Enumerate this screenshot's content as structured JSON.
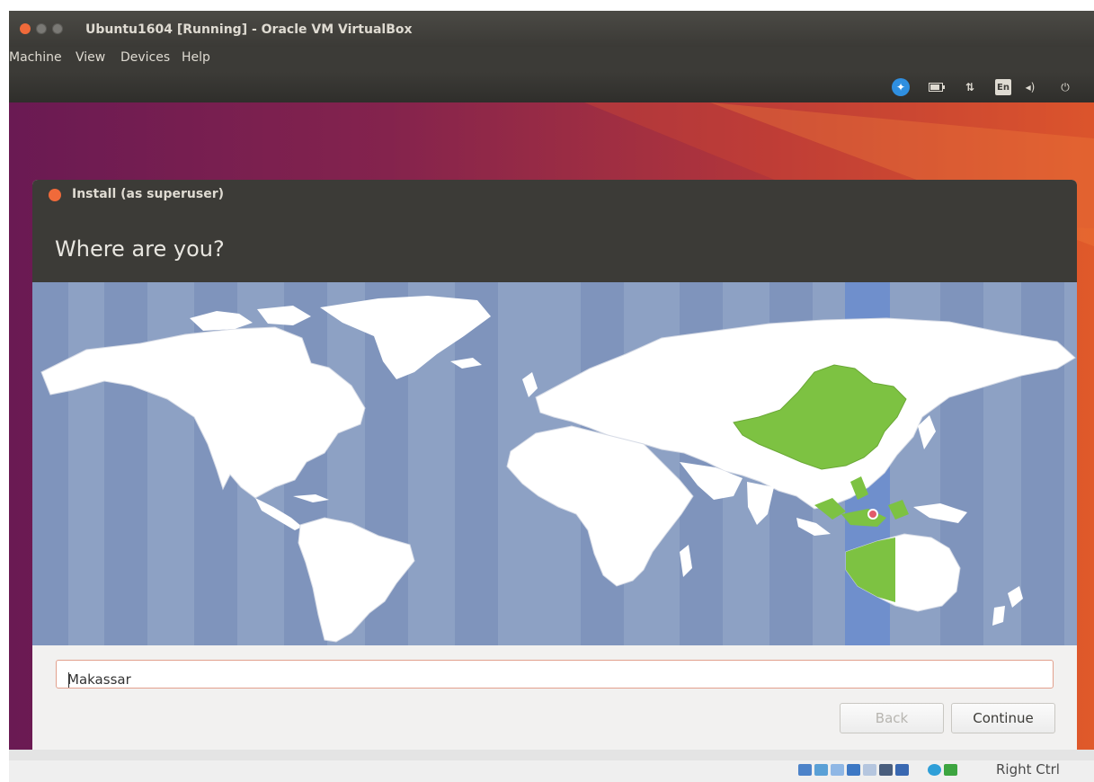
{
  "vbox": {
    "title": "Ubuntu1604 [Running] - Oracle VM VirtualBox",
    "menu": [
      "Machine",
      "View",
      "Devices",
      "Help"
    ],
    "host_key": "Right Ctrl"
  },
  "guest_panel": {
    "keyboard_layout": "En"
  },
  "installer": {
    "window_title": "Install (as superuser)",
    "heading": "Where are you?",
    "timezone_value": "Makassar",
    "back_label": "Back",
    "continue_label": "Continue"
  },
  "colors": {
    "selected_region": "#7dc242",
    "selected_timezone_band": "#6f8fcc",
    "ocean": "#8da1c4",
    "land": "#ffffff",
    "accent_orange": "#f06a3a"
  }
}
